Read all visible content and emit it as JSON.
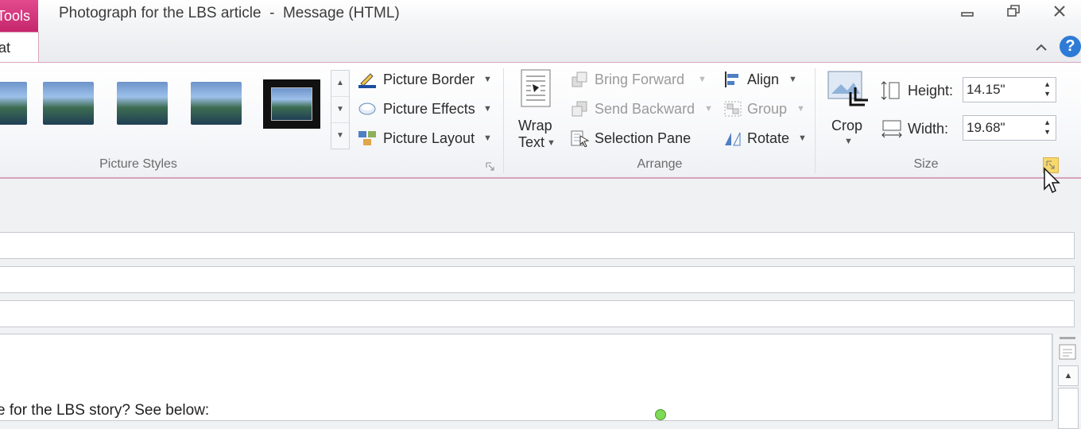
{
  "window": {
    "tools_tab": "Tools",
    "format_tab": "at",
    "title": "Photograph for the LBS article  -  Message (HTML)",
    "minimize_glyph": "▭",
    "restore_glyph": "❐",
    "close_glyph": "✕",
    "help_glyph": "?",
    "collapse_glyph": "⌃"
  },
  "ribbon": {
    "picture_styles": {
      "label": "Picture Styles",
      "commands": {
        "border": "Picture Border",
        "effects": "Picture Effects",
        "layout": "Picture Layout"
      }
    },
    "arrange": {
      "label": "Arrange",
      "wrap_text_line1": "Wrap",
      "wrap_text_line2": "Text",
      "bring_forward": "Bring Forward",
      "send_backward": "Send Backward",
      "selection_pane": "Selection Pane",
      "align": "Align",
      "group": "Group",
      "rotate": "Rotate"
    },
    "size": {
      "label": "Size",
      "crop": "Crop",
      "height_label": "Height:",
      "height_value": "14.15\"",
      "width_label": "Width:",
      "width_value": "19.68\""
    }
  },
  "message": {
    "body_text": "e for the LBS story?  See below:"
  },
  "icons": [
    "picture-border-icon",
    "picture-effects-icon",
    "picture-layout-icon",
    "wrap-text-icon",
    "bring-forward-icon",
    "send-backward-icon",
    "selection-pane-icon",
    "align-icon",
    "group-icon",
    "rotate-icon",
    "crop-icon",
    "height-icon",
    "width-icon",
    "dialog-launcher-icon",
    "mouse-cursor-icon",
    "help-icon"
  ],
  "colors": {
    "accent_pink": "#c5266c",
    "help_blue": "#2d7bd6",
    "dialog_launcher_highlight": "#f7d86b"
  }
}
